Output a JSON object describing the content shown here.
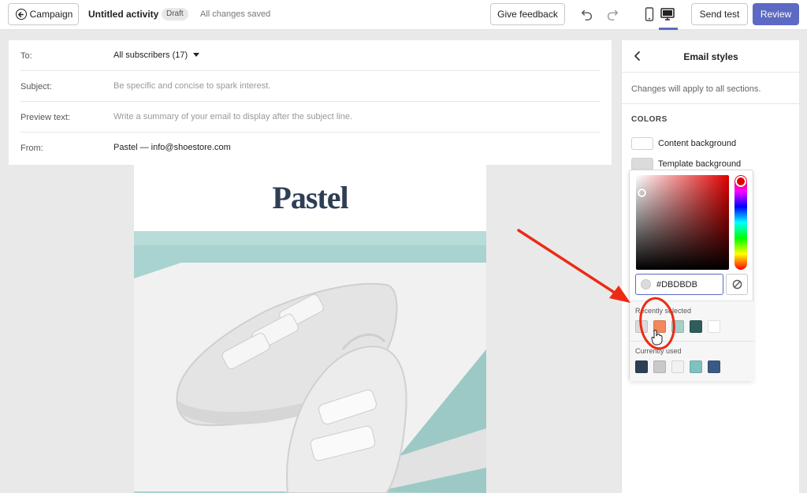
{
  "topbar": {
    "back_label": "Campaign",
    "title": "Untitled activity",
    "draft_badge": "Draft",
    "saved_status": "All changes saved",
    "feedback_label": "Give feedback",
    "send_test_label": "Send test",
    "review_label": "Review",
    "accent": "#5c6ac4"
  },
  "form": {
    "to_label": "To:",
    "to_value": "All subscribers (17)",
    "subject_label": "Subject:",
    "subject_placeholder": "Be specific and concise to spark interest.",
    "preview_label": "Preview text:",
    "preview_placeholder": "Write a summary of your email to display after the subject line.",
    "from_label": "From:",
    "from_value": "Pastel — info@shoestore.com"
  },
  "email": {
    "logo_text": "Pastel",
    "logo_color": "#2d3e55",
    "hero_bg": "#a8d3d0"
  },
  "panel": {
    "title": "Email styles",
    "note": "Changes will apply to all sections.",
    "colors_heading": "COLORS",
    "rows": [
      {
        "label": "Content background",
        "color": "#ffffff"
      },
      {
        "label": "Template background",
        "color": "#dbdbdb"
      }
    ]
  },
  "picker": {
    "hex_value": "#DBDBDB",
    "recently_label": "Recently selected",
    "recently": [
      "#dbdbdb",
      "#f2885e",
      "#a7cfc8",
      "#2f5d5a",
      "#ffffff"
    ],
    "current_label": "Currently used",
    "current": [
      "#2d3e55",
      "#c9c9c9",
      "#f2f2f2",
      "#7fc1bd",
      "#3a5a85"
    ]
  },
  "annotation": {
    "color": "#ee2a15"
  }
}
